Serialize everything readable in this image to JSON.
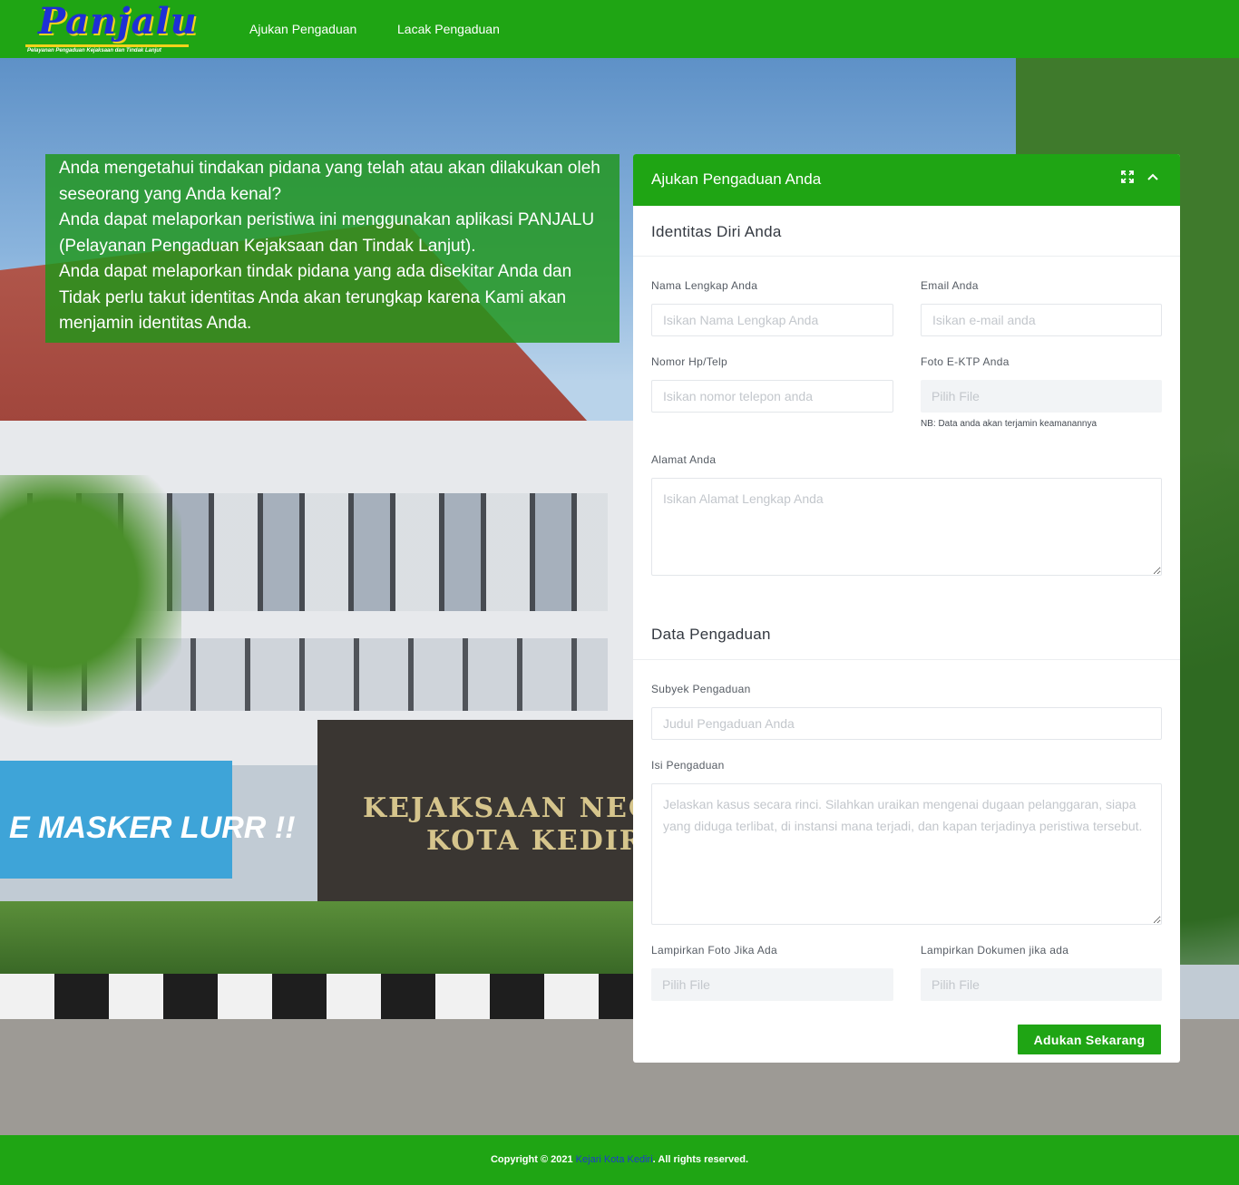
{
  "brand": {
    "logo_text": "Panjalu",
    "tagline": "Pelayanan Pengaduan Kejaksaan dan Tindak Lanjut"
  },
  "nav": {
    "items": [
      {
        "label": "Ajukan Pengaduan"
      },
      {
        "label": "Lacak Pengaduan"
      }
    ]
  },
  "background": {
    "sign_text_line1": "KEJAKSAAN NEG",
    "sign_text_line2": "KOTA KEDIR",
    "banner_text": "E MASKER LURR !!"
  },
  "info": {
    "paragraphs": [
      "Anda mengetahui tindakan pidana yang telah atau akan dilakukan oleh seseorang yang Anda kenal?",
      "Anda dapat melaporkan peristiwa ini menggunakan aplikasi PANJALU (Pelayanan Pengaduan Kejaksaan dan Tindak Lanjut).",
      "Anda dapat melaporkan tindak pidana yang ada disekitar Anda dan Tidak perlu takut identitas Anda akan terungkap karena Kami akan menjamin identitas Anda."
    ]
  },
  "form": {
    "title": "Ajukan Pengaduan Anda",
    "icons": {
      "expand": "expand-icon",
      "collapse": "chevron-up-icon"
    },
    "section_identity": "Identitas Diri Anda",
    "name": {
      "label": "Nama Lengkap Anda",
      "placeholder": "Isikan Nama Lengkap Anda",
      "value": ""
    },
    "email": {
      "label": "Email Anda",
      "placeholder": "Isikan e-mail anda",
      "value": ""
    },
    "phone": {
      "label": "Nomor Hp/Telp",
      "placeholder": "Isikan nomor telepon anda",
      "value": ""
    },
    "ktp": {
      "label": "Foto E-KTP Anda",
      "button": "Pilih File",
      "note": "NB: Data anda akan terjamin keamanannya"
    },
    "address": {
      "label": "Alamat Anda",
      "placeholder": "Isikan Alamat Lengkap Anda",
      "value": ""
    },
    "section_complaint": "Data Pengaduan",
    "subject": {
      "label": "Subyek Pengaduan",
      "placeholder": "Judul Pengaduan Anda",
      "value": ""
    },
    "content": {
      "label": "Isi Pengaduan",
      "placeholder": "Jelaskan kasus secara rinci. Silahkan uraikan mengenai dugaan pelanggaran, siapa yang diduga terlibat, di instansi mana terjadi, dan kapan terjadinya peristiwa tersebut.",
      "value": ""
    },
    "photo": {
      "label": "Lampirkan Foto Jika Ada",
      "button": "Pilih File"
    },
    "document": {
      "label": "Lampirkan Dokumen jika ada",
      "button": "Pilih File"
    },
    "submit_label": "Adukan Sekarang"
  },
  "footer": {
    "prefix": "Copyright © 2021",
    "link": "Kejari Kota Kediri",
    "suffix": ". All rights reserved."
  },
  "colors": {
    "primary_green": "#1fa514",
    "link_blue": "#1d3ccc"
  }
}
